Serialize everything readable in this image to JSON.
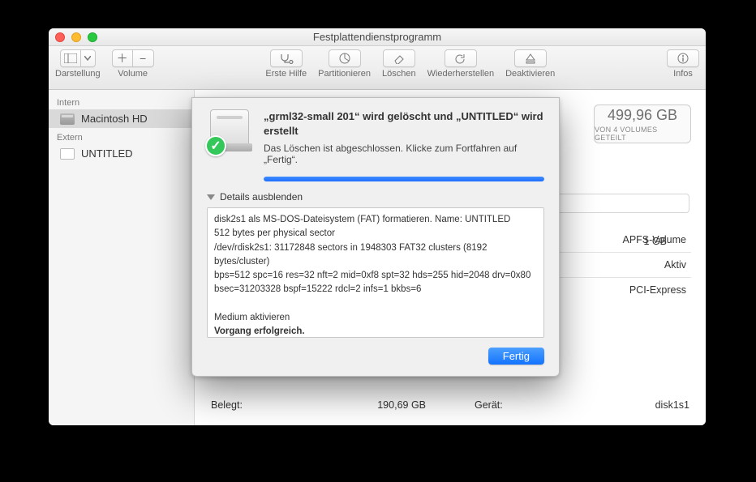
{
  "window": {
    "title": "Festplattendienstprogramm"
  },
  "toolbar": {
    "view": "Darstellung",
    "volume": "Volume",
    "firstaid": "Erste Hilfe",
    "partition": "Partitionieren",
    "erase": "Löschen",
    "restore": "Wiederherstellen",
    "unmount": "Deaktivieren",
    "info": "Infos"
  },
  "sidebar": {
    "internal": "Intern",
    "external": "Extern",
    "items": [
      {
        "label": "Macintosh HD"
      },
      {
        "label": "UNTITLED"
      }
    ]
  },
  "capacity": {
    "value": "499,96 GB",
    "sub": "VON 4 VOLUMES GETEILT"
  },
  "gb_hint": "1 GB",
  "info_rows": [
    {
      "k": "",
      "v": "APFS-Volume"
    },
    {
      "k": "",
      "v": "Aktiv"
    },
    {
      "k": "",
      "v": "PCI-Express"
    }
  ],
  "bottom": {
    "used_k": "Belegt:",
    "used_v": "190,69 GB",
    "device_k": "Gerät:",
    "device_v": "disk1s1"
  },
  "sheet": {
    "title": "„grml32-small 201“ wird gelöscht und „UNTITLED“ wird erstellt",
    "subtitle": "Das Löschen ist abgeschlossen. Klicke zum Fortfahren auf „Fertig“.",
    "disclosure": "Details ausblenden",
    "log": "disk2s1 als MS-DOS-Dateisystem (FAT) formatieren. Name: UNTITLED\n512 bytes per physical sector\n/dev/rdisk2s1: 31172848 sectors in 1948303 FAT32 clusters (8192 bytes/cluster)\nbps=512 spc=16 res=32 nft=2 mid=0xf8 spt=32 hds=255 hid=2048 drv=0x80 bsec=31203328 bspf=15222 rdcl=2 infs=1 bkbs=6\n\nMedium aktivieren\n",
    "success": "Vorgang erfolgreich.",
    "done": "Fertig"
  }
}
